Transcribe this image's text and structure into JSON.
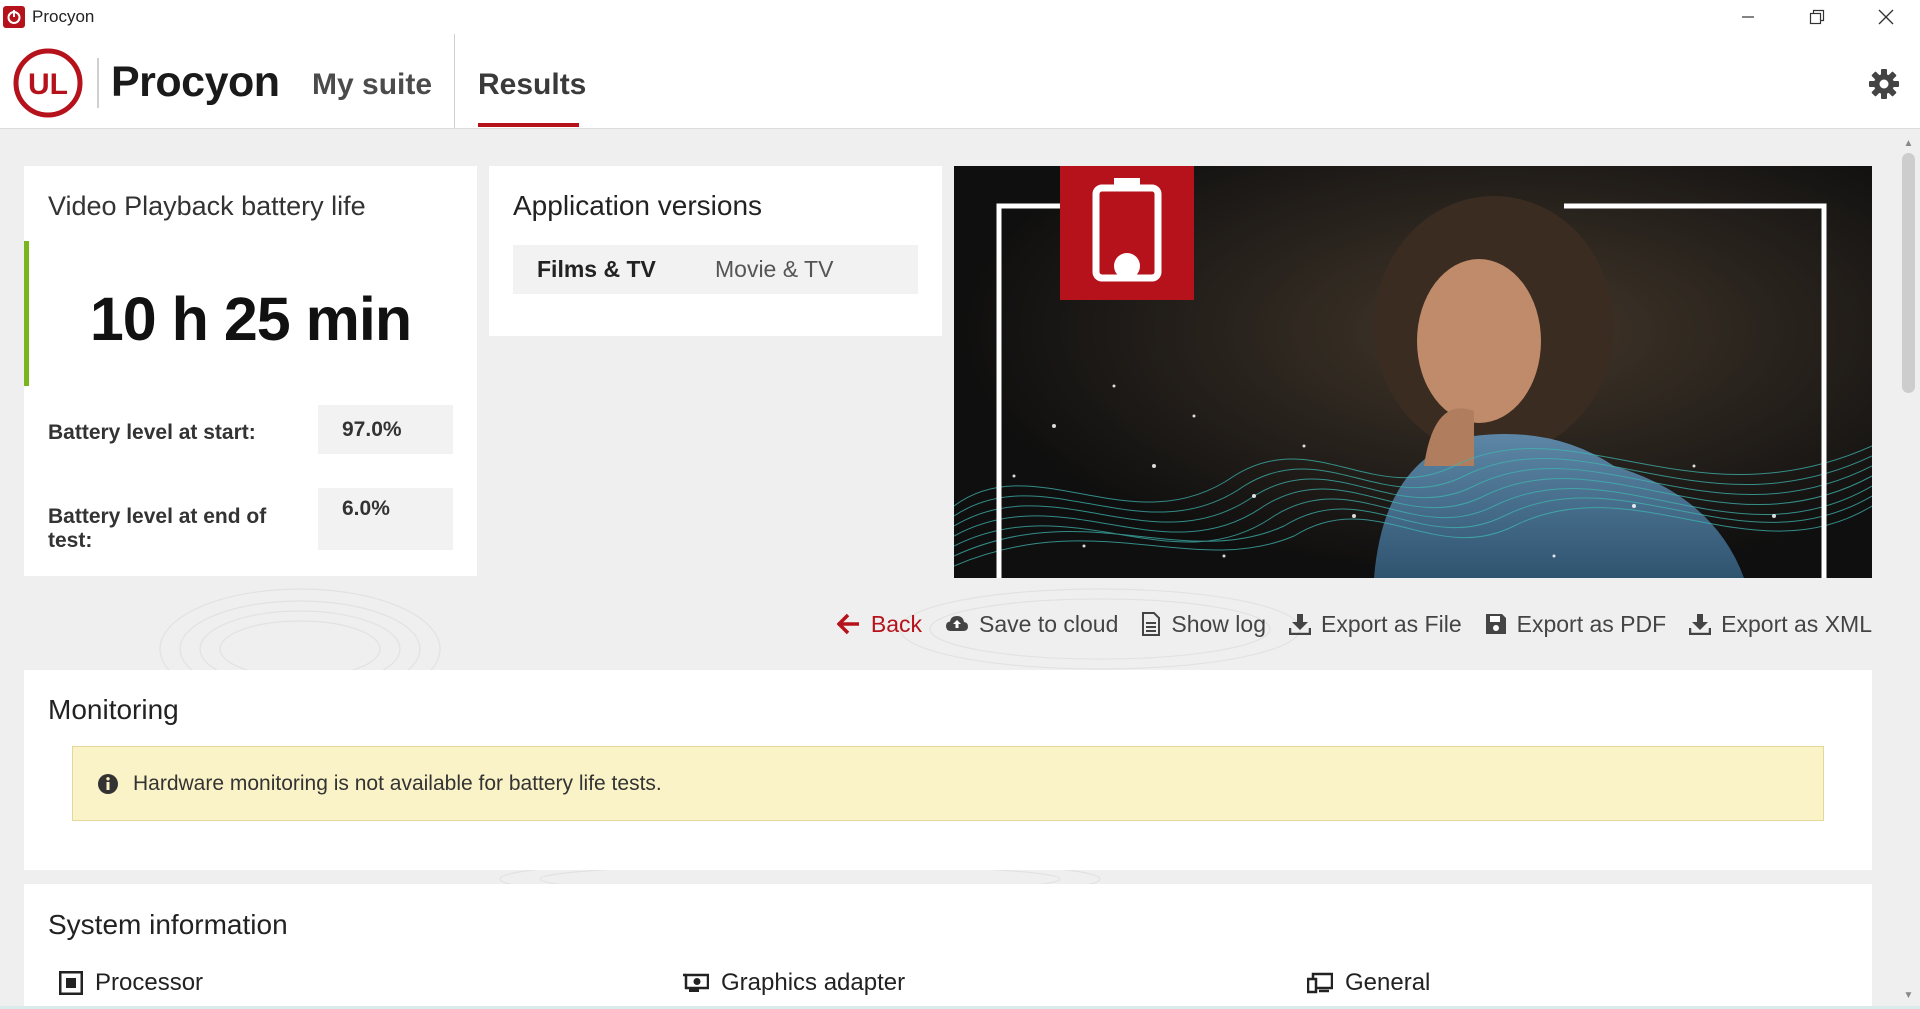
{
  "window": {
    "title": "Procyon"
  },
  "header": {
    "logo_text": "UL",
    "brand": "Procyon",
    "nav": [
      {
        "label": "My suite",
        "active": false
      },
      {
        "label": "Results",
        "active": true
      }
    ]
  },
  "battery": {
    "title": "Video Playback battery life",
    "value": "10 h 25 min",
    "start_label": "Battery level at start:",
    "start_value": "97.0%",
    "end_label": "Battery level at end of test:",
    "end_value": "6.0%"
  },
  "app_versions": {
    "title": "Application versions",
    "rows": [
      {
        "name": "Films & TV",
        "value": "Movie & TV"
      }
    ]
  },
  "actions": [
    {
      "label": "Back",
      "icon": "back-arrow-icon"
    },
    {
      "label": "Save to cloud",
      "icon": "cloud-upload-icon"
    },
    {
      "label": "Show log",
      "icon": "document-icon"
    },
    {
      "label": "Export as File",
      "icon": "download-icon"
    },
    {
      "label": "Export as PDF",
      "icon": "save-icon"
    },
    {
      "label": "Export as XML",
      "icon": "download-icon"
    }
  ],
  "monitoring": {
    "title": "Monitoring",
    "notice": "Hardware monitoring is not available for battery life tests."
  },
  "system_info": {
    "title": "System information",
    "items": [
      {
        "label": "Processor",
        "icon": "processor-icon"
      },
      {
        "label": "Graphics adapter",
        "icon": "graphics-card-icon"
      },
      {
        "label": "General",
        "icon": "monitor-icon"
      }
    ]
  },
  "colors": {
    "brand_red": "#b5121b",
    "accent_green": "#7ab51d",
    "notice_yellow": "#faf3c8"
  }
}
